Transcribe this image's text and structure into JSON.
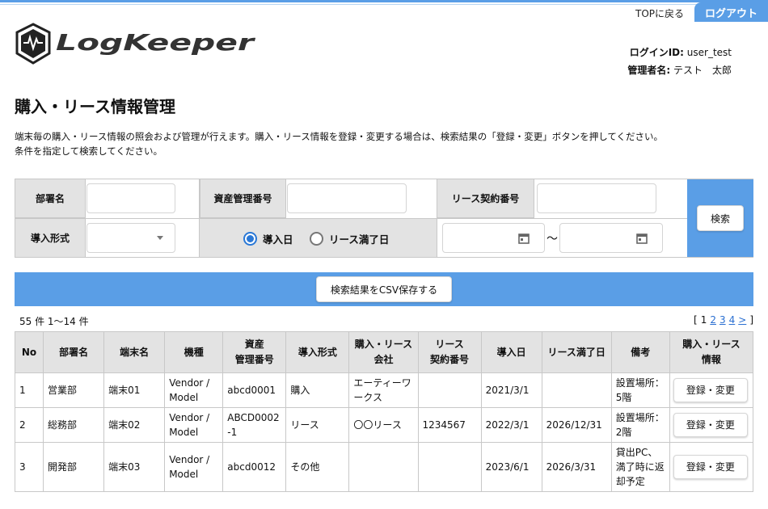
{
  "header": {
    "top_link": "TOPに戻る",
    "logout": "ログアウト",
    "logo_text": "LogKeeper",
    "login_id_label": "ログインID:",
    "login_id_value": "user_test",
    "admin_label": "管理者名:",
    "admin_value": "テスト　太郎",
    "accent": "#5a9ee6"
  },
  "page": {
    "title": "購入・リース情報管理",
    "desc_line1": "端末毎の購入・リース情報の照会および管理が行えます。購入・リース情報を登録・変更する場合は、検索結果の「登録・変更」ボタンを押してください。",
    "desc_line2": "条件を指定して検索してください。"
  },
  "search": {
    "dept_label": "部署名",
    "dept_value": "",
    "asset_label": "資産管理番号",
    "asset_value": "",
    "lease_no_label": "リース契約番号",
    "lease_no_value": "",
    "type_label": "導入形式",
    "type_value": "",
    "radio_intro": "導入日",
    "radio_lease": "リース満了日",
    "radio_selected": "導入日",
    "date_from": "",
    "date_to": "",
    "tilde": "～",
    "search_button": "検索"
  },
  "csv": {
    "button": "検索結果をCSV保存する"
  },
  "results": {
    "count": "55 件 1〜14 件",
    "pager": {
      "open": "[",
      "current": "1",
      "pages": [
        "2",
        "3",
        "4"
      ],
      "next": ">",
      "close": "]"
    },
    "headers": [
      "No",
      "部署名",
      "端末名",
      "機種",
      "資産\n管理番号",
      "導入形式",
      "購入・リース\n会社",
      "リース\n契約番号",
      "導入日",
      "リース満了日",
      "備考",
      "購入・リース\n情報"
    ],
    "rows": [
      {
        "no": "1",
        "dept": "営業部",
        "terminal": "端末01",
        "model": "Vendor / Model",
        "asset": "abcd0001",
        "type": "購入",
        "company": "エーティーワークス",
        "lease_no": "",
        "intro": "2021/3/1",
        "expiry": "",
        "note": "設置場所：5階",
        "button": "登録・変更"
      },
      {
        "no": "2",
        "dept": "総務部",
        "terminal": "端末02",
        "model": "Vendor / Model",
        "asset": "ABCD0002-1",
        "type": "リース",
        "company": "〇〇リース",
        "lease_no": "1234567",
        "intro": "2022/3/1",
        "expiry": "2026/12/31",
        "note": "設置場所：2階",
        "button": "登録・変更"
      },
      {
        "no": "3",
        "dept": "開発部",
        "terminal": "端末03",
        "model": "Vendor / Model",
        "asset": "abcd0012",
        "type": "その他",
        "company": "",
        "lease_no": "",
        "intro": "2023/6/1",
        "expiry": "2026/3/31",
        "note": "貸出PC、満了時に返却予定",
        "button": "登録・変更"
      }
    ]
  }
}
